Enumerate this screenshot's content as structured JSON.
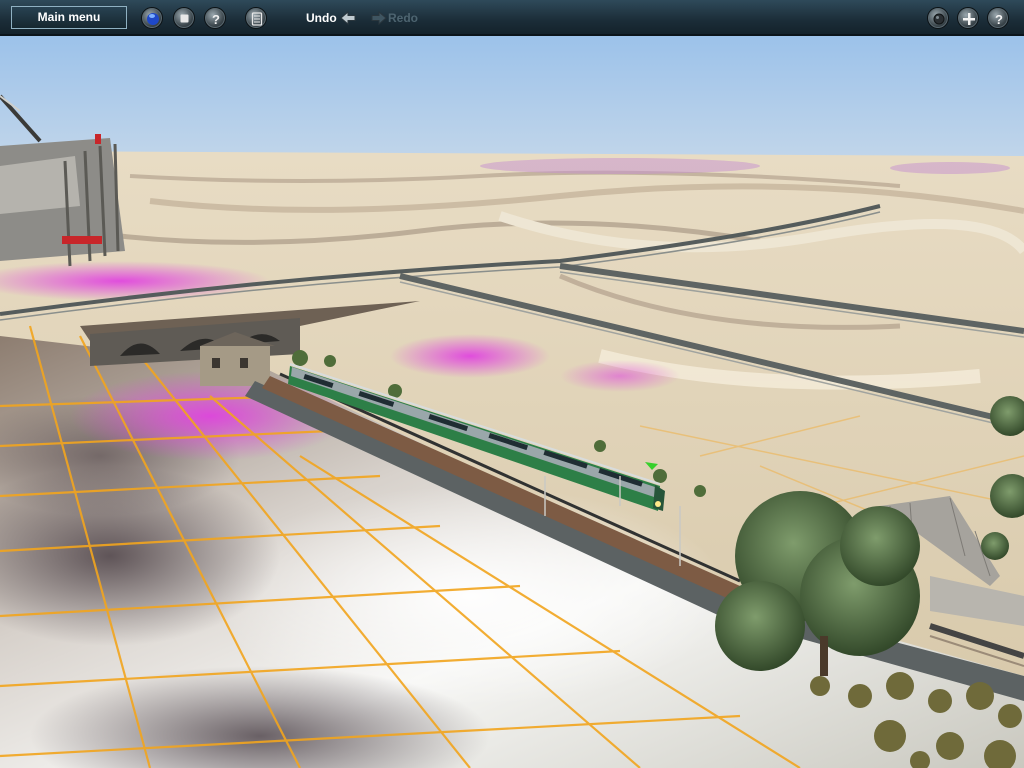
{
  "toolbar": {
    "main_menu_label": "Main menu",
    "undo_label": "Undo",
    "redo_label": "Redo",
    "left_tools": [
      {
        "name": "globe-mode-icon",
        "color": "#2b5bd0"
      },
      {
        "name": "stop-icon",
        "color": "#d8d8d8"
      },
      {
        "name": "help-tool-icon",
        "color": "#e6e6e6"
      },
      {
        "name": "calculator-icon",
        "color": "#e6e6e6"
      }
    ],
    "right_tools": [
      {
        "name": "camera-dot-icon"
      },
      {
        "name": "add-icon"
      },
      {
        "name": "help-icon"
      }
    ]
  },
  "viewport": {
    "sky_color": "#8db3dd",
    "grid_color": "#f2a51e",
    "highlight_color": "#d838d8",
    "train_color": "#2f8a4a",
    "tree_color": "#4d6b3d"
  }
}
